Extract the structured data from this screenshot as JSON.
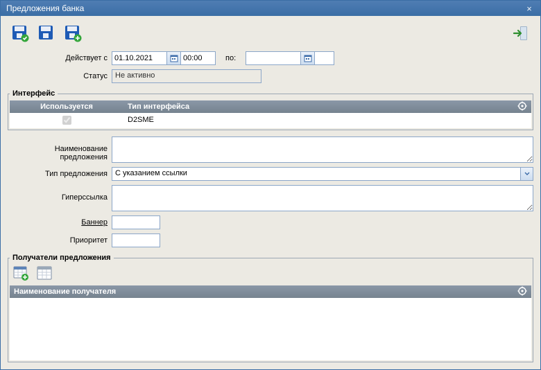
{
  "window": {
    "title": "Предложения банка"
  },
  "toolbar": {
    "save_apply": "Сохранить и применить",
    "save": "Сохранить",
    "save_new": "Сохранить как новый",
    "exit": "Выход"
  },
  "form": {
    "valid_from_label": "Действует с",
    "valid_from_date": "01.10.2021",
    "valid_from_time": "00:00",
    "to_label": "по:",
    "to_date": "",
    "to_time": "",
    "status_label": "Статус",
    "status_value": "Не активно"
  },
  "interface_fs": {
    "legend": "Интерфейс",
    "col_used": "Используется",
    "col_type": "Тип интерфейса",
    "rows": [
      {
        "used": true,
        "type": "D2SME"
      }
    ]
  },
  "labels": {
    "offer_name": "Наименование предложения",
    "offer_type": "Тип предложения",
    "offer_type_value": "С указанием ссылки",
    "hyperlink": "Гиперссылка",
    "banner": "Баннер",
    "priority": "Приоритет"
  },
  "values": {
    "offer_name": "",
    "hyperlink": "",
    "banner": "",
    "priority": ""
  },
  "recipients": {
    "legend": "Получатели предложения",
    "col_name": "Наименование получателя"
  }
}
